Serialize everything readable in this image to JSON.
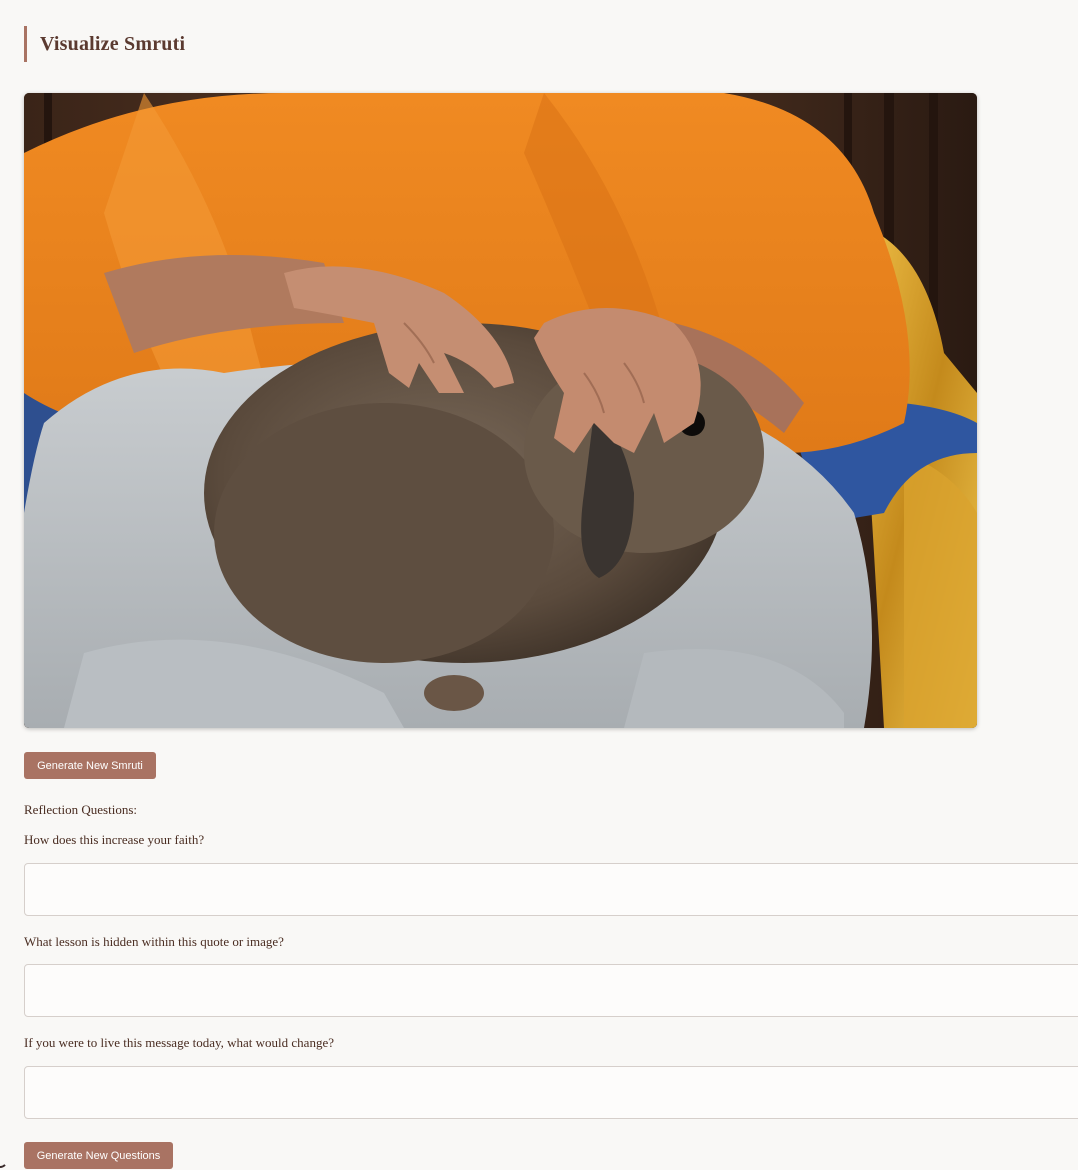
{
  "header": {
    "title": "Visualize Smruti"
  },
  "smruti": {
    "image_description_icon": "photo",
    "generate_button_label": "Generate New Smruti"
  },
  "reflection": {
    "heading": "Reflection Questions:",
    "questions": [
      {
        "text": "How does this increase your faith?",
        "answer": "",
        "placeholder": ""
      },
      {
        "text": "What lesson is hidden within this quote or image?",
        "answer": "",
        "placeholder": ""
      },
      {
        "text": "If you were to live this message today, what would change?",
        "answer": "",
        "placeholder": ""
      }
    ],
    "generate_button_label": "Generate New Questions"
  },
  "colors": {
    "accent": "#a97363",
    "background": "#f9f8f6",
    "text": "#4a2d22"
  }
}
